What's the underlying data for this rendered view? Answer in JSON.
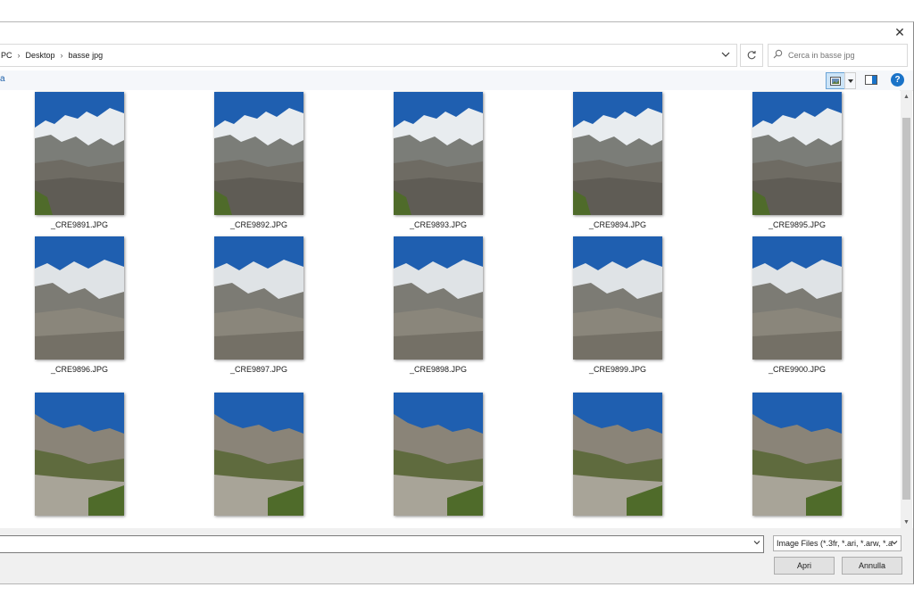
{
  "window": {
    "close_glyph": "✕"
  },
  "address": {
    "breadcrumbs": [
      {
        "label": "PC"
      },
      {
        "label": "Desktop"
      },
      {
        "label": "basse jpg"
      }
    ],
    "separator": "›"
  },
  "search": {
    "placeholder": "Cerca in basse jpg"
  },
  "toolbar": {
    "left_fragment": "a",
    "help_glyph": "?"
  },
  "files": [
    {
      "name": "_CRE9891.JPG",
      "variant": "a"
    },
    {
      "name": "_CRE9892.JPG",
      "variant": "a"
    },
    {
      "name": "_CRE9893.JPG",
      "variant": "a"
    },
    {
      "name": "_CRE9894.JPG",
      "variant": "a"
    },
    {
      "name": "_CRE9895.JPG",
      "variant": "a"
    },
    {
      "name": "_CRE9896.JPG",
      "variant": "b"
    },
    {
      "name": "_CRE9897.JPG",
      "variant": "b"
    },
    {
      "name": "_CRE9898.JPG",
      "variant": "b"
    },
    {
      "name": "_CRE9899.JPG",
      "variant": "b"
    },
    {
      "name": "_CRE9900.JPG",
      "variant": "b"
    },
    {
      "name": "",
      "variant": "c"
    },
    {
      "name": "",
      "variant": "c"
    },
    {
      "name": "",
      "variant": "c"
    },
    {
      "name": "",
      "variant": "c"
    },
    {
      "name": "",
      "variant": "c"
    }
  ],
  "footer": {
    "filename_value": "",
    "file_type": "Image Files (*.3fr, *.ari, *.arw, *.a",
    "open_label": "Apri",
    "cancel_label": "Annulla"
  },
  "colors": {
    "sky": "#1f5fb0",
    "accent": "#1a73c8",
    "selected_view": "#cce4f7"
  }
}
